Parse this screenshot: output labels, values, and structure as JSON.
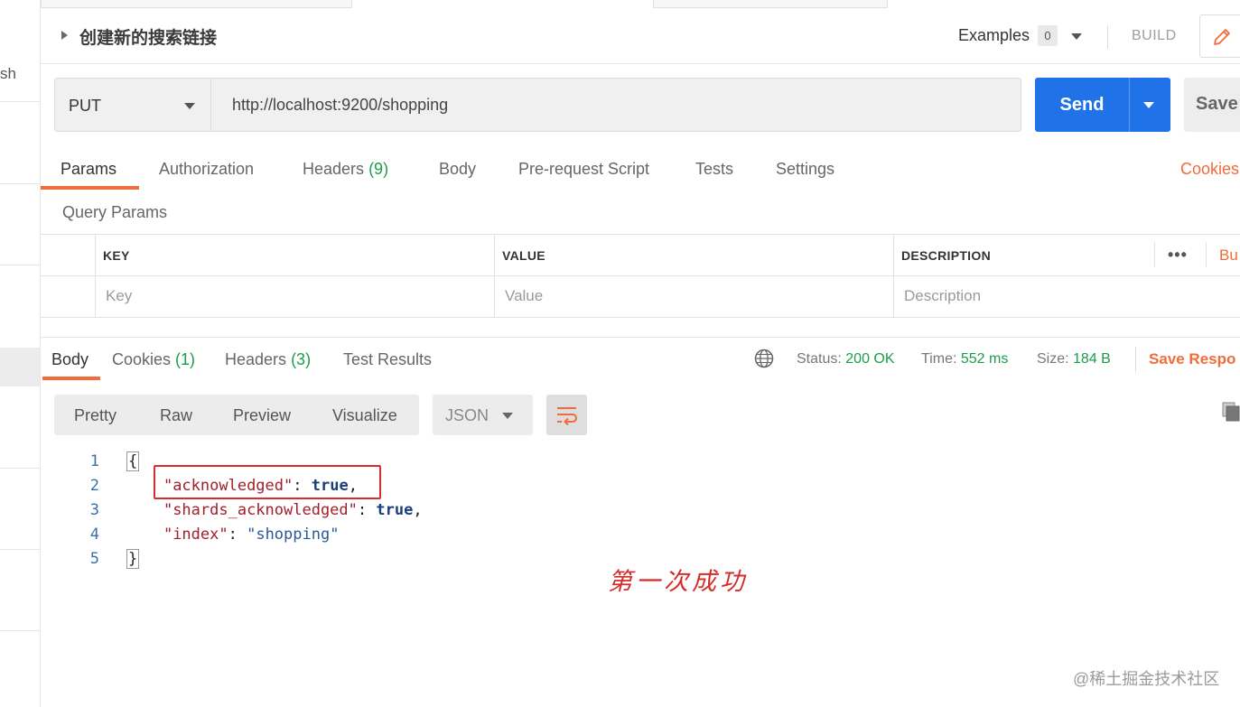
{
  "sidebar": {
    "partial_text": "sh"
  },
  "request": {
    "title": "创建新的搜索链接",
    "examples_label": "Examples",
    "examples_count": "0",
    "build_label": "BUILD",
    "method": "PUT",
    "url": "http://localhost:9200/shopping",
    "send_label": "Send",
    "save_label": "Save"
  },
  "request_tabs": {
    "params": "Params",
    "authorization": "Authorization",
    "headers": "Headers",
    "headers_count": "(9)",
    "body": "Body",
    "prerequest": "Pre-request Script",
    "tests": "Tests",
    "settings": "Settings",
    "cookies": "Cookies"
  },
  "query_params": {
    "label": "Query Params",
    "columns": [
      "KEY",
      "VALUE",
      "DESCRIPTION"
    ],
    "placeholders": [
      "Key",
      "Value",
      "Description"
    ],
    "more": "•••",
    "bulk_edit": "Bu"
  },
  "response_tabs": {
    "body": "Body",
    "cookies": "Cookies",
    "cookies_count": "(1)",
    "headers": "Headers",
    "headers_count": "(3)",
    "test_results": "Test Results"
  },
  "status": {
    "status_label": "Status:",
    "status_value": "200 OK",
    "time_label": "Time:",
    "time_value": "552 ms",
    "size_label": "Size:",
    "size_value": "184 B",
    "save_response": "Save Respo"
  },
  "view": {
    "modes": [
      "Pretty",
      "Raw",
      "Preview",
      "Visualize"
    ],
    "format": "JSON"
  },
  "code": {
    "line_numbers": [
      "1",
      "2",
      "3",
      "4",
      "5"
    ],
    "open_brace": "{",
    "close_brace": "}",
    "key1": "\"acknowledged\"",
    "val1": "true",
    "key2": "\"shards_acknowledged\"",
    "val2": "true",
    "key3": "\"index\"",
    "val3": "\"shopping\""
  },
  "annotation": "第一次成功",
  "watermark": "@稀土掘金技术社区",
  "colors": {
    "accent": "#f26b3a",
    "send": "#1f72e8",
    "success": "#1a9e4a",
    "annotation": "#d42b2b"
  },
  "icons": [
    "caret-right-icon",
    "pencil-icon",
    "globe-icon",
    "wrap-lines-icon",
    "copy-icon"
  ]
}
